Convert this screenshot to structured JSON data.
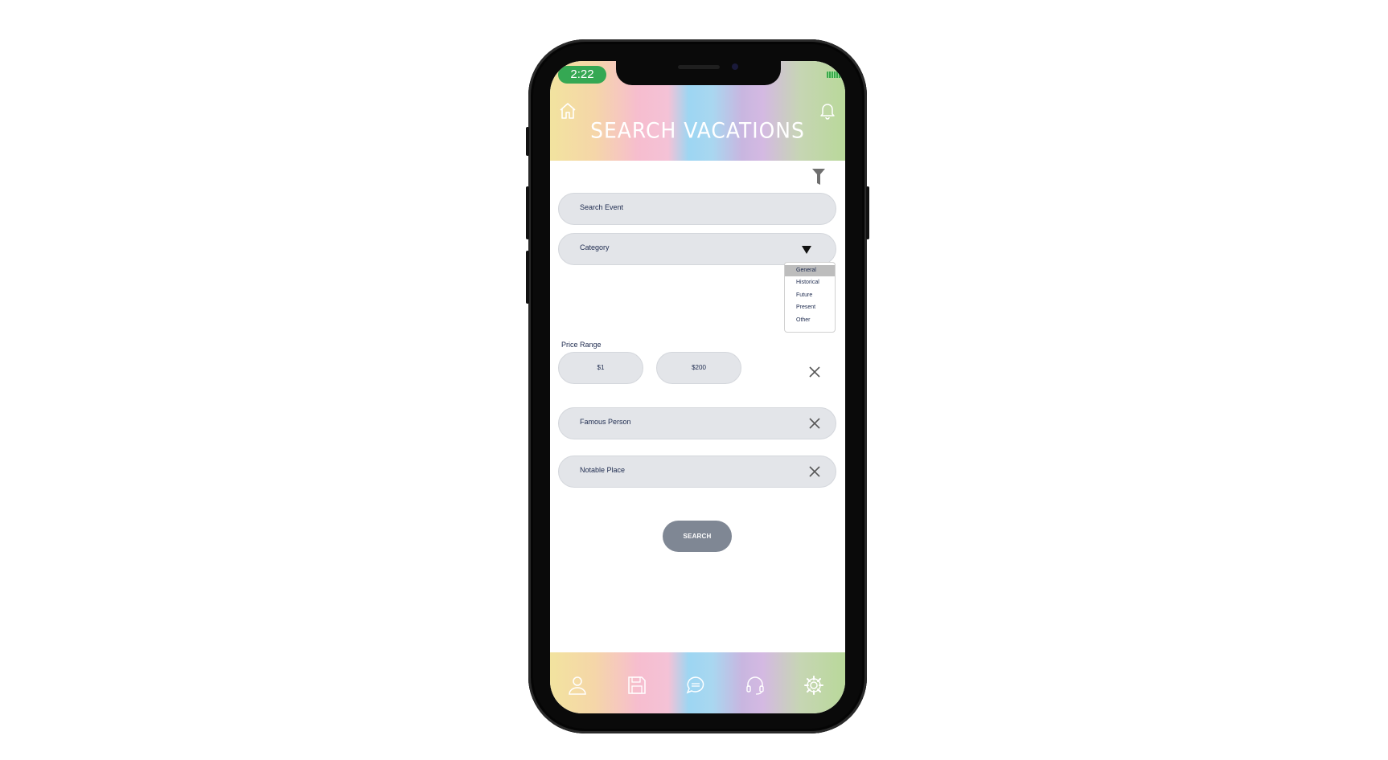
{
  "status": {
    "time": "2:22"
  },
  "header": {
    "title": "SEARCH VACATIONS"
  },
  "search": {
    "placeholder": "Search Event"
  },
  "category": {
    "label": "Category",
    "options": [
      "General",
      "Historical",
      "Future",
      "Present",
      "Other"
    ],
    "selected": "General"
  },
  "price": {
    "label": "Price Range",
    "min": "$1",
    "max": "$200"
  },
  "famous": {
    "label": "Famous Person"
  },
  "notable": {
    "label": "Notable Place"
  },
  "actions": {
    "search_label": "SEARCH"
  },
  "nav": [
    "profile-icon",
    "save-icon",
    "chat-icon",
    "support-headset-icon",
    "settings-gear-icon"
  ],
  "colors": {
    "time_pill": "#35a853",
    "field_bg": "#e3e5e9",
    "search_button": "#7f8794",
    "label_text": "#1d2a4e"
  }
}
